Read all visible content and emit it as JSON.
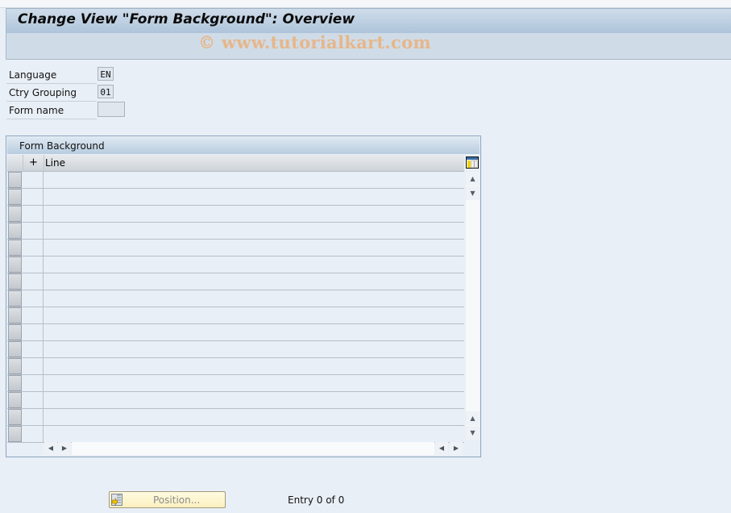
{
  "window": {
    "title": "Change View \"Form Background\": Overview",
    "watermark": "© www.tutorialkart.com"
  },
  "fields": {
    "language": {
      "label": "Language",
      "value": "EN"
    },
    "ctry_grouping": {
      "label": "Ctry Grouping",
      "value": "01"
    },
    "form_name": {
      "label": "Form name",
      "value": ""
    }
  },
  "table": {
    "title": "Form Background",
    "columns": [
      "+",
      "Line"
    ],
    "config_icon": "table-settings-icon",
    "row_count_visible": 16,
    "rows": []
  },
  "footer": {
    "position_button": "Position...",
    "entry_text": "Entry 0 of 0"
  },
  "colors": {
    "title_bar": "#aec4da",
    "background": "#e9eff6",
    "watermark": "#e7b68a",
    "button_bg": "#fbf0c0"
  }
}
